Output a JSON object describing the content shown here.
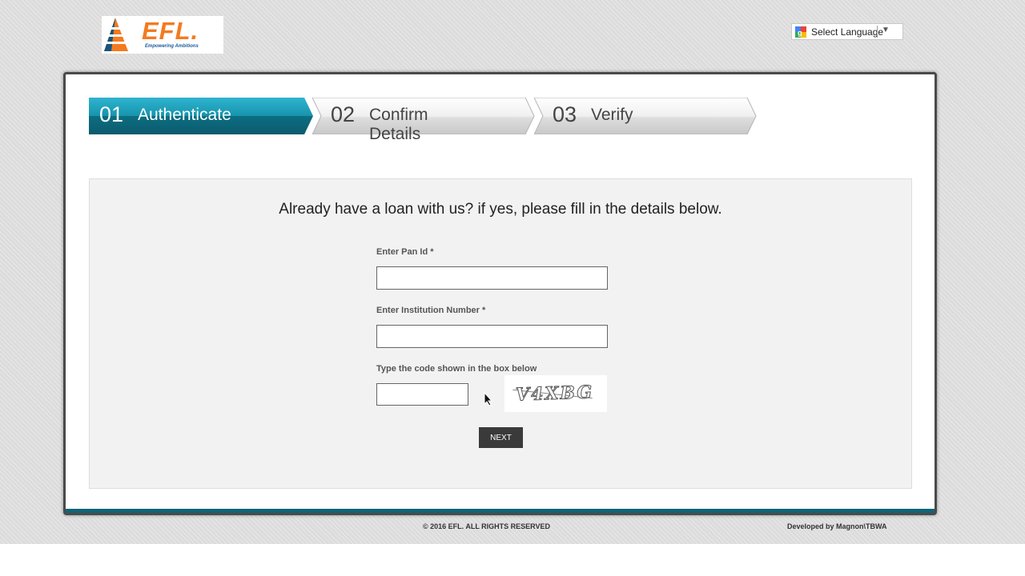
{
  "header": {
    "logo_text": "EFL.",
    "logo_tagline": "Empowering Ambitions",
    "language_label": "Select Language",
    "language_arrow": "▼"
  },
  "steps": [
    {
      "number": "01",
      "label": "Authenticate",
      "active": true
    },
    {
      "number": "02",
      "label": "Confirm Details",
      "active": false
    },
    {
      "number": "03",
      "label": "Verify",
      "active": false
    }
  ],
  "form": {
    "headline": "Already have a loan with us? if yes, please fill in the details below.",
    "pan_label": "Enter Pan Id *",
    "pan_value": "",
    "institution_label": "Enter Institution Number *",
    "institution_value": "",
    "captcha_label": "Type the code shown in the box below",
    "captcha_value": "",
    "captcha_code": "V4XBG",
    "next_label": "NEXT"
  },
  "footer": {
    "copyright": "© 2016 EFL. ALL RIGHTS RESERVED",
    "developed_by": "Developed by Magnon\\TBWA"
  },
  "colors": {
    "active_step": "#1794ad",
    "logo_orange": "#f47a20",
    "panel_bar": "#0e6576",
    "next_button": "#3a3a3a"
  }
}
